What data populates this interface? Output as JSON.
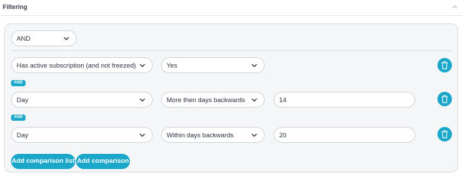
{
  "header": {
    "title": "Filtering"
  },
  "filter": {
    "operator": "AND",
    "rows": [
      {
        "field": "Has active subscription (and not freezed)",
        "condition": "Yes",
        "value": null
      },
      {
        "field": "Day",
        "condition": "More then days backwards",
        "value": "14"
      },
      {
        "field": "Day",
        "condition": "Within days backwards",
        "value": "20"
      }
    ],
    "connector_badges": [
      "AND",
      "AND"
    ]
  },
  "buttons": {
    "add_comparison_list": "Add comparison list",
    "add_comparison": "Add comparison"
  },
  "icons": {
    "collapse": "chevron-up-icon",
    "dropdown": "chevron-down-icon",
    "delete": "trash-icon"
  },
  "colors": {
    "accent": "#1aa7c9",
    "panel_bg": "#f5f6f8",
    "border": "#cfd4db"
  }
}
